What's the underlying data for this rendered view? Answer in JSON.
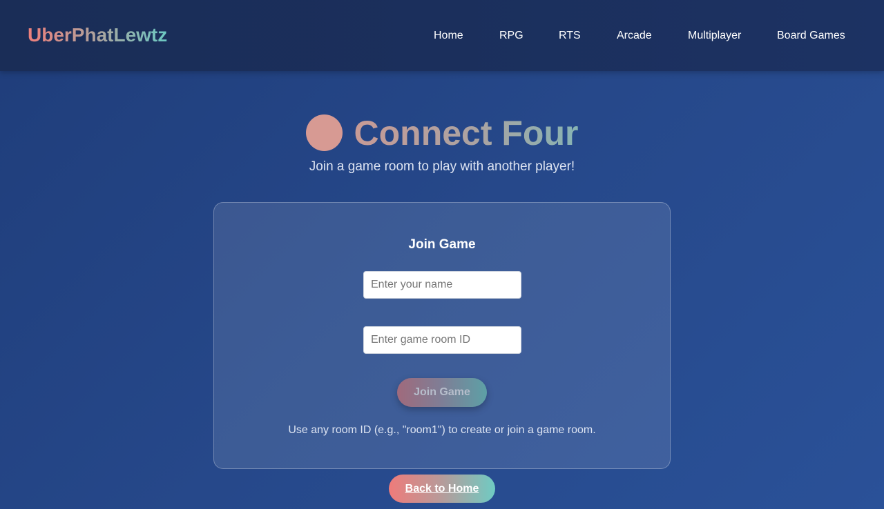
{
  "header": {
    "logo": "UberPhatLewtz",
    "nav": [
      {
        "label": "Home"
      },
      {
        "label": "RPG"
      },
      {
        "label": "RTS"
      },
      {
        "label": "Arcade"
      },
      {
        "label": "Multiplayer"
      },
      {
        "label": "Board Games"
      }
    ]
  },
  "main": {
    "title": "Connect Four",
    "subtitle": "Join a game room to play with another player!"
  },
  "card": {
    "title": "Join Game",
    "name_placeholder": "Enter your name",
    "name_value": "",
    "room_placeholder": "Enter game room ID",
    "room_value": "",
    "join_label": "Join Game",
    "hint": "Use any room ID (e.g., \"room1\") to create or join a game room."
  },
  "footer": {
    "back_label": "Back to Home"
  },
  "colors": {
    "accent_coral": "#ef7f7b",
    "accent_teal": "#6cc9c3",
    "header_bg": "#1a2d57",
    "page_bg": "#26488a"
  }
}
